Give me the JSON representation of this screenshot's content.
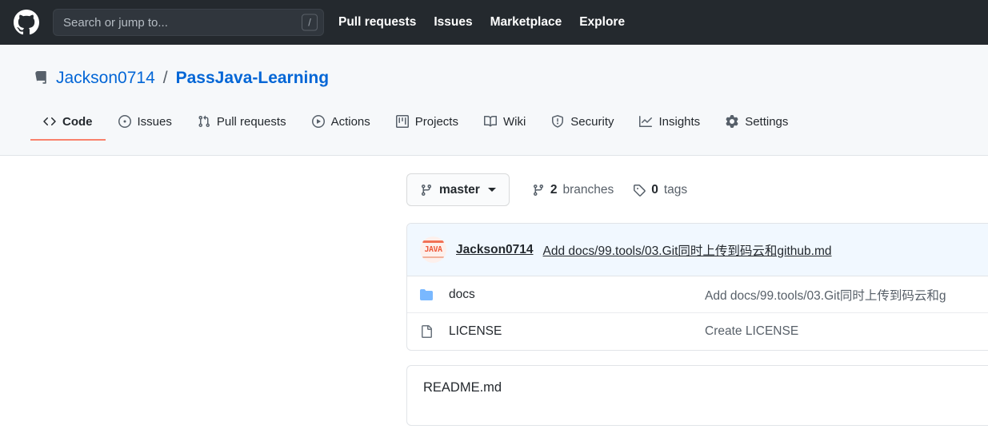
{
  "header": {
    "logo_icon": "github-mark-icon",
    "search": {
      "placeholder": "Search or jump to...",
      "value": "",
      "shortcut_key": "/"
    },
    "nav": [
      {
        "label": "Pull requests"
      },
      {
        "label": "Issues"
      },
      {
        "label": "Marketplace"
      },
      {
        "label": "Explore"
      }
    ],
    "bg_color": "#24292e"
  },
  "repo": {
    "icon": "repo-icon",
    "owner": "Jackson0714",
    "separator": "/",
    "name": "PassJava-Learning",
    "link_color": "#0366d6",
    "tabs": [
      {
        "label": "Code",
        "icon": "code-icon",
        "active": true
      },
      {
        "label": "Issues",
        "icon": "issue-opened-icon",
        "active": false
      },
      {
        "label": "Pull requests",
        "icon": "git-pull-request-icon",
        "active": false
      },
      {
        "label": "Actions",
        "icon": "play-icon",
        "active": false
      },
      {
        "label": "Projects",
        "icon": "project-icon",
        "active": false
      },
      {
        "label": "Wiki",
        "icon": "book-icon",
        "active": false
      },
      {
        "label": "Security",
        "icon": "shield-icon",
        "active": false
      },
      {
        "label": "Insights",
        "icon": "graph-icon",
        "active": false
      },
      {
        "label": "Settings",
        "icon": "gear-icon",
        "active": false
      }
    ],
    "active_tab_underline_color": "#f9826c"
  },
  "code_view": {
    "branch_selector": {
      "icon": "git-branch-icon",
      "label": "master",
      "caret": "chevron-down-icon"
    },
    "branches": {
      "icon": "git-branch-icon",
      "count": "2",
      "label": "branches"
    },
    "tags": {
      "icon": "tag-icon",
      "count": "0",
      "label": "tags"
    },
    "latest_commit": {
      "avatar_icon": "java-avatar",
      "avatar_text": "JAVA",
      "author": "Jackson0714",
      "message": "Add docs/99.tools/03.Git同时上传到码云和github.md"
    },
    "files": [
      {
        "icon": "folder-icon",
        "name": "docs",
        "commit_message": "Add docs/99.tools/03.Git同时上传到码云和g"
      },
      {
        "icon": "file-icon",
        "name": "LICENSE",
        "commit_message": "Create LICENSE"
      }
    ],
    "readme": {
      "title": "README.md"
    }
  }
}
